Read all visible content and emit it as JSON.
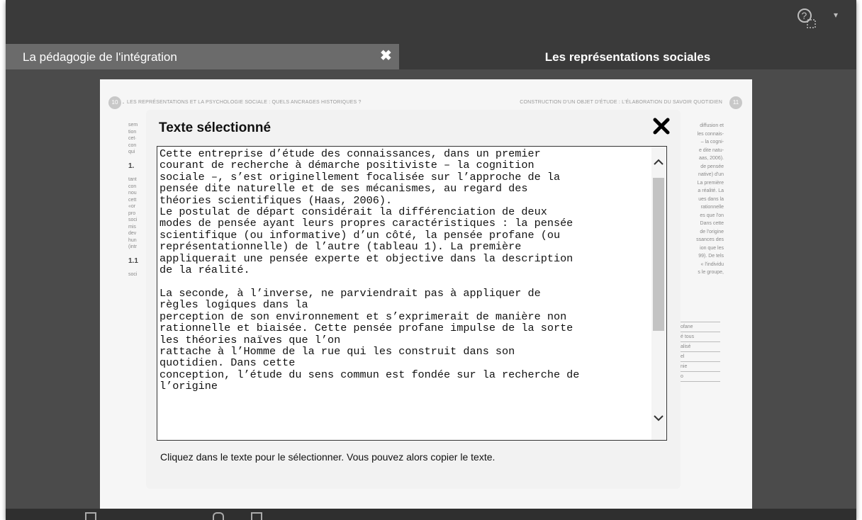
{
  "tabs": {
    "left_label": "La pédagogie de l'intégration",
    "close_glyph": "✖",
    "right_label": "Les représentations sociales"
  },
  "toolbar": {
    "help_icon": "help-selection-icon",
    "caret": "▾"
  },
  "page": {
    "header_left": "LES REPRÉSENTATIONS ET LA PSYCHOLOGIE SOCIALE : QUELS ANCRAGES HISTORIQUES ?",
    "header_right": "CONSTRUCTION D'UN OBJET D'ÉTUDE : L'ÉLABORATION DU SAVOIR QUOTIDIEN",
    "page_left_num": "10",
    "page_right_num": "11",
    "left_col": [
      "sem",
      "tion",
      "cet·",
      "con",
      "qui",
      "1.",
      "tant",
      "con",
      "nou",
      "cett",
      "«or",
      "pro",
      "soci",
      "mis",
      "dev",
      "hun",
      "(intr",
      "1.1",
      "soci"
    ],
    "right_col": [
      "diffusion et",
      "les connais-",
      "– la cogni-",
      "e dite natu-",
      "aas, 2006).",
      "de pensée",
      "native) d'un",
      "La première",
      "a réalité. La",
      "ues dans la",
      "rationnelle",
      "es que l'on",
      "Dans cette",
      "de l'origine",
      "ssances des",
      "ion que les",
      "99). De tels",
      "« l'individu",
      "s le groupe,"
    ],
    "table_cells": [
      "ofane",
      "é tous",
      "alisé",
      "el",
      "nie",
      "o"
    ]
  },
  "modal": {
    "title": "Texte sélectionné",
    "text": "Cette entreprise d’étude des connaissances, dans un premier\ncourant de recherche à démarche positiviste – la cognition\nsociale –, s’est originellement focalisée sur l’approche de la\npensée dite naturelle et de ses mécanismes, au regard des\nthéories scientifiques (Haas, 2006).\nLe postulat de départ considérait la différenciation de deux\nmodes de pensée ayant leurs propres caractéristiques : la pensée\nscientifique (ou informative) d’un côté, la pensée profane (ou\nreprésentationnelle) de l’autre (tableau 1). La première\nappliquerait une pensée experte et objective dans la description\nde la réalité.\n\nLa seconde, à l’inverse, ne parviendrait pas à appliquer de\nrègles logiques dans la\nperception de son environnement et s’exprimerait de manière non\nrationnelle et biaisée. Cette pensée profane impulse de la sorte\nles théories naïves que l’on\nrattache à l’Homme de la rue qui les construit dans son\nquotidien. Dans cette\nconception, l’étude du sens commun est fondée sur la recherche de\nl’origine",
    "hint": "Cliquez dans le texte pour le sélectionner. Vous pouvez alors copier le texte."
  }
}
